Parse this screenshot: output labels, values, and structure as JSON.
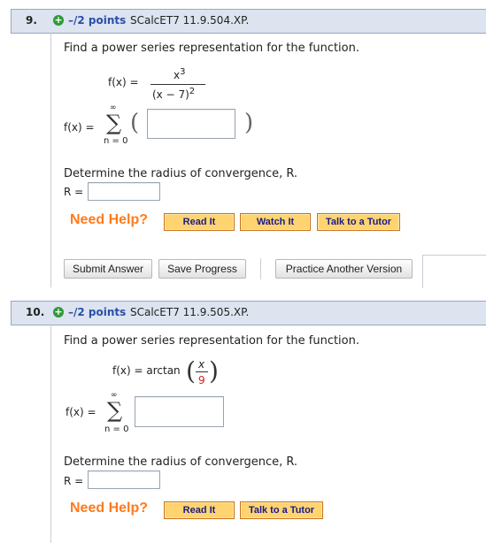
{
  "q9": {
    "number": "9.",
    "plus": "+",
    "points": "–/2 points",
    "code": "SCalcET7 11.9.504.XP.",
    "prompt": "Find a power series representation for the function.",
    "fx_label": "f(x)  =",
    "numerator": "x",
    "numerator_exp": "3",
    "denominator": "(x − 7)",
    "denominator_exp": "2",
    "series_lhs": "f(x)  =",
    "sigma": "∑",
    "sigma_top": "∞",
    "sigma_bottom": "n = 0",
    "paren_open": "(",
    "paren_close": ")",
    "radius_prompt": "Determine the radius of convergence, R.",
    "r_label": "R  =",
    "need_help": "Need Help?",
    "read_it": "Read It",
    "watch_it": "Watch It",
    "talk_tutor": "Talk to a Tutor",
    "submit": "Submit Answer",
    "save": "Save Progress",
    "practice": "Practice Another Version"
  },
  "q10": {
    "number": "10.",
    "plus": "+",
    "points": "–/2 points",
    "code": "SCalcET7 11.9.505.XP.",
    "prompt": "Find a power series representation for the function.",
    "fx_label": "f(x)  =  arctan",
    "frac_num": "x",
    "frac_den": "9",
    "series_lhs": "f(x)  =",
    "sigma": "∑",
    "sigma_top": "∞",
    "sigma_bottom": "n = 0",
    "radius_prompt": "Determine the radius of convergence, R.",
    "r_label": "R  =",
    "need_help": "Need Help?",
    "read_it": "Read It",
    "talk_tutor": "Talk to a Tutor"
  },
  "colors": {
    "header_bg": "#dde4f0",
    "points": "#2a4fa8",
    "need_help": "#ff7a1a",
    "help_btn": "#ffd470",
    "red_digit": "#d62020"
  }
}
